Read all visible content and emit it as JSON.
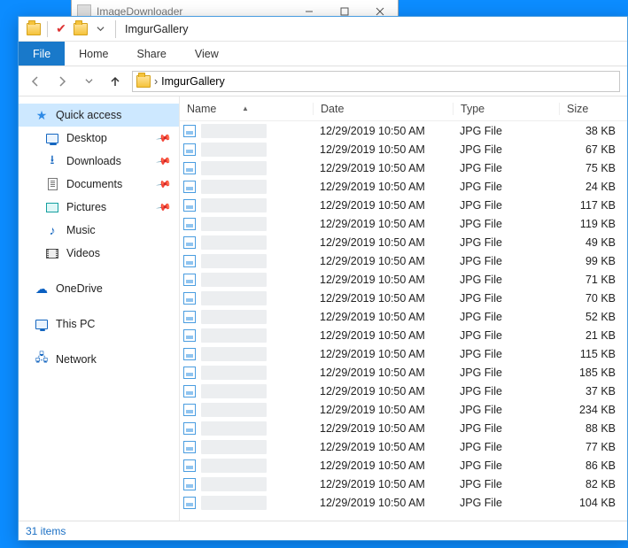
{
  "background_window": {
    "title": "ImageDownloader"
  },
  "explorer": {
    "title": "ImgurGallery",
    "ribbon_tabs": {
      "file": "File",
      "home": "Home",
      "share": "Share",
      "view": "View"
    },
    "breadcrumb": {
      "folder": "ImgurGallery"
    },
    "nav": {
      "quick_access": "Quick access",
      "desktop": "Desktop",
      "downloads": "Downloads",
      "documents": "Documents",
      "pictures": "Pictures",
      "music": "Music",
      "videos": "Videos",
      "onedrive": "OneDrive",
      "this_pc": "This PC",
      "network": "Network"
    },
    "columns": {
      "name": "Name",
      "date": "Date",
      "type": "Type",
      "size": "Size"
    },
    "files": [
      {
        "date": "12/29/2019 10:50 AM",
        "type": "JPG File",
        "size": "38 KB"
      },
      {
        "date": "12/29/2019 10:50 AM",
        "type": "JPG File",
        "size": "67 KB"
      },
      {
        "date": "12/29/2019 10:50 AM",
        "type": "JPG File",
        "size": "75 KB"
      },
      {
        "date": "12/29/2019 10:50 AM",
        "type": "JPG File",
        "size": "24 KB"
      },
      {
        "date": "12/29/2019 10:50 AM",
        "type": "JPG File",
        "size": "117 KB"
      },
      {
        "date": "12/29/2019 10:50 AM",
        "type": "JPG File",
        "size": "119 KB"
      },
      {
        "date": "12/29/2019 10:50 AM",
        "type": "JPG File",
        "size": "49 KB"
      },
      {
        "date": "12/29/2019 10:50 AM",
        "type": "JPG File",
        "size": "99 KB"
      },
      {
        "date": "12/29/2019 10:50 AM",
        "type": "JPG File",
        "size": "71 KB"
      },
      {
        "date": "12/29/2019 10:50 AM",
        "type": "JPG File",
        "size": "70 KB"
      },
      {
        "date": "12/29/2019 10:50 AM",
        "type": "JPG File",
        "size": "52 KB"
      },
      {
        "date": "12/29/2019 10:50 AM",
        "type": "JPG File",
        "size": "21 KB"
      },
      {
        "date": "12/29/2019 10:50 AM",
        "type": "JPG File",
        "size": "115 KB"
      },
      {
        "date": "12/29/2019 10:50 AM",
        "type": "JPG File",
        "size": "185 KB"
      },
      {
        "date": "12/29/2019 10:50 AM",
        "type": "JPG File",
        "size": "37 KB"
      },
      {
        "date": "12/29/2019 10:50 AM",
        "type": "JPG File",
        "size": "234 KB"
      },
      {
        "date": "12/29/2019 10:50 AM",
        "type": "JPG File",
        "size": "88 KB"
      },
      {
        "date": "12/29/2019 10:50 AM",
        "type": "JPG File",
        "size": "77 KB"
      },
      {
        "date": "12/29/2019 10:50 AM",
        "type": "JPG File",
        "size": "86 KB"
      },
      {
        "date": "12/29/2019 10:50 AM",
        "type": "JPG File",
        "size": "82 KB"
      },
      {
        "date": "12/29/2019 10:50 AM",
        "type": "JPG File",
        "size": "104 KB"
      }
    ],
    "status": "31 items"
  }
}
